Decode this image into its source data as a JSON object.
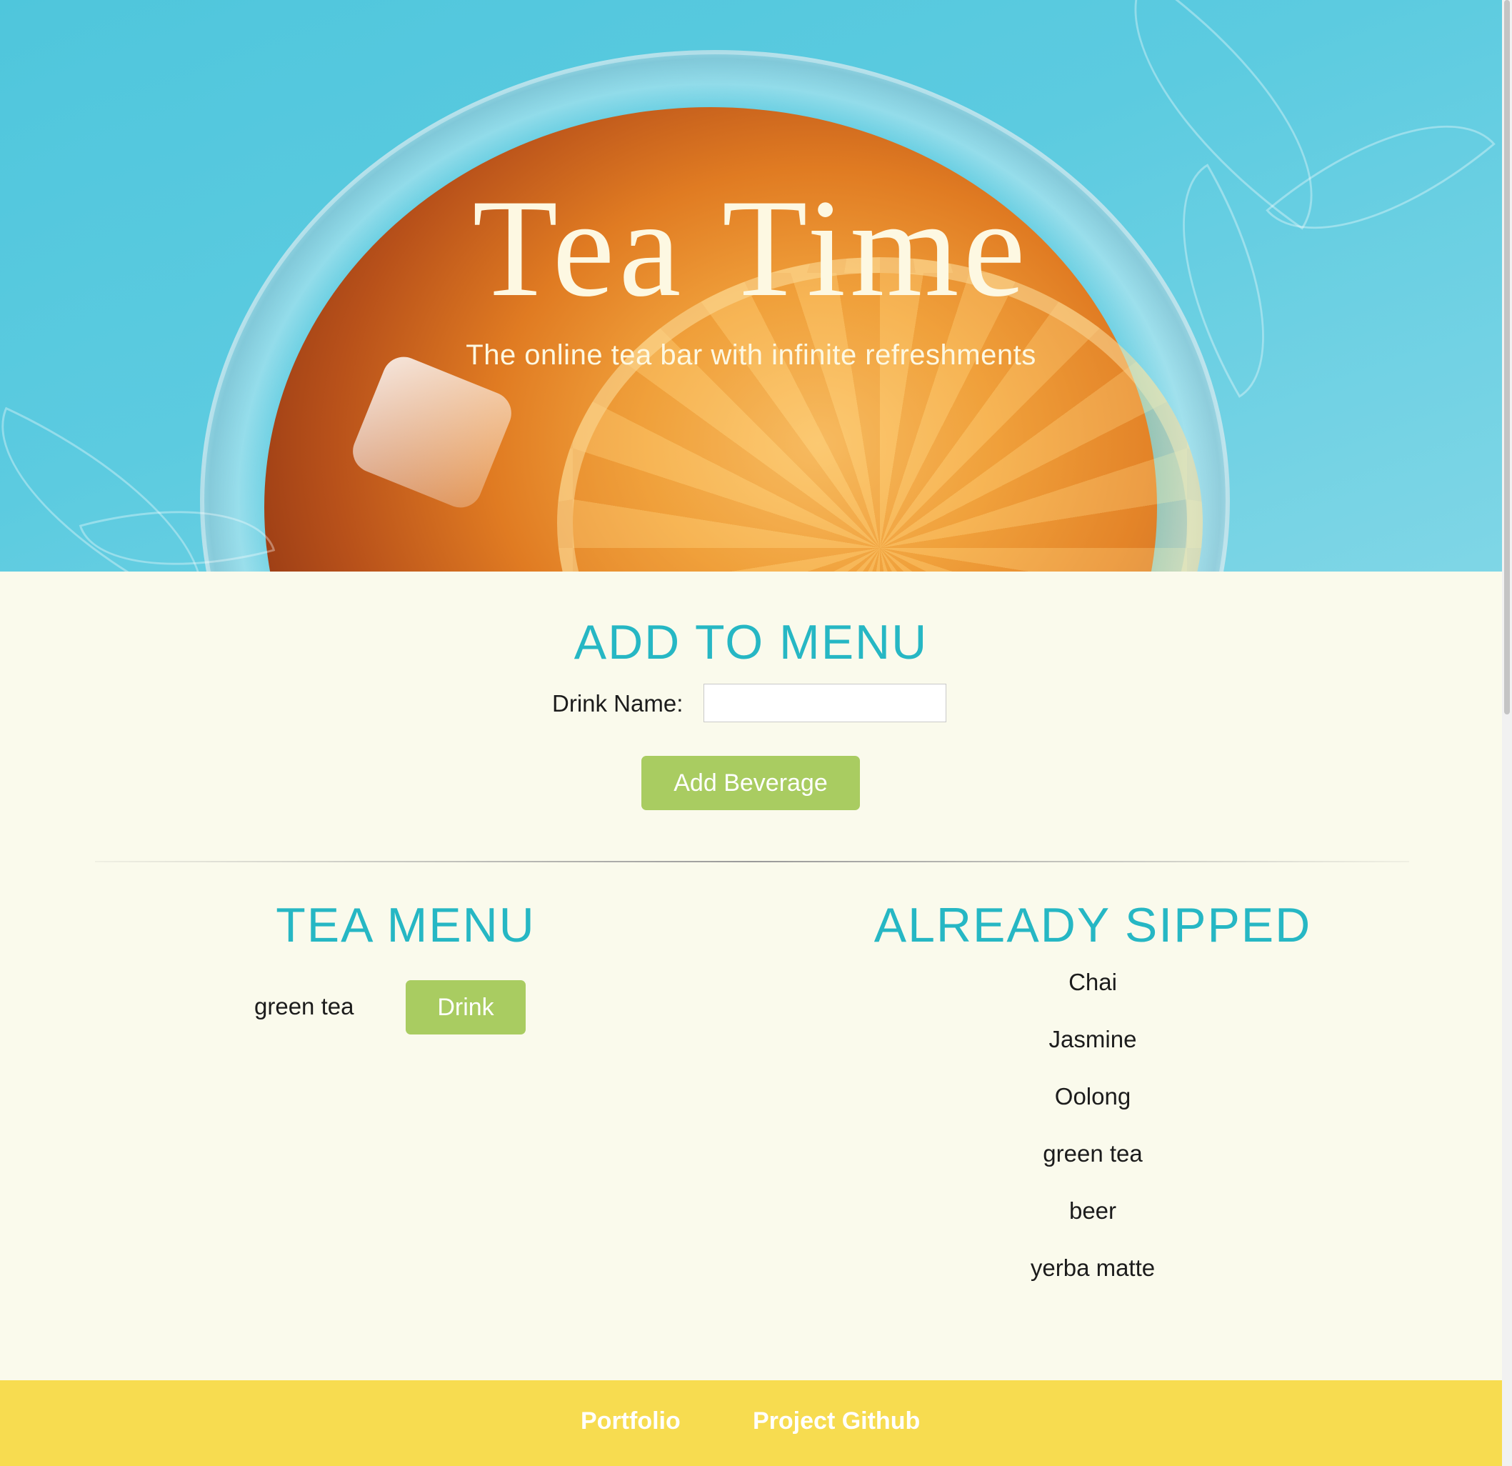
{
  "hero": {
    "title": "Tea Time",
    "subtitle": "The online tea bar with infinite refreshments"
  },
  "add_section": {
    "heading": "ADD TO MENU",
    "drink_name_label": "Drink Name:",
    "drink_name_value": "",
    "add_button_label": "Add Beverage"
  },
  "tea_menu": {
    "heading": "TEA MENU",
    "items": [
      {
        "name": "green tea",
        "button_label": "Drink"
      }
    ]
  },
  "already_sipped": {
    "heading": "ALREADY SIPPED",
    "items": [
      "Chai",
      "Jasmine",
      "Oolong",
      "green tea",
      "beer",
      "yerba matte"
    ]
  },
  "footer": {
    "links": [
      "Portfolio",
      "Project Github"
    ]
  },
  "colors": {
    "heading_teal": "#26b7c4",
    "button_green": "#a9cc61",
    "footer_yellow": "#f7dc50",
    "page_background": "#fafaec",
    "hero_text": "#fdf8e2"
  }
}
